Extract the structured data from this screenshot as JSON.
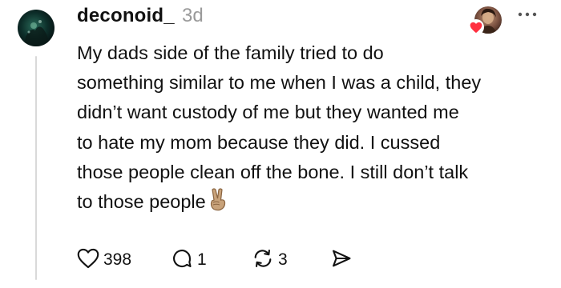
{
  "post": {
    "username": "deconoid_",
    "timestamp": "3d",
    "text_lines": [
      "My dads side of the family tried to do",
      "something similar to me when I was a child, they",
      "didn’t want custody of me but they wanted me",
      "to hate my mom because they did. I cussed",
      "those people clean off the bone. I still don’t talk",
      "to those people"
    ],
    "trailing_emoji": "victory-hand-icon"
  },
  "actions": {
    "likes": "398",
    "replies": "1",
    "reposts": "3"
  },
  "colors": {
    "heart": "#ff3040",
    "text": "#111111",
    "muted": "#9a9a9a",
    "thread_line": "#d9d9d9"
  }
}
